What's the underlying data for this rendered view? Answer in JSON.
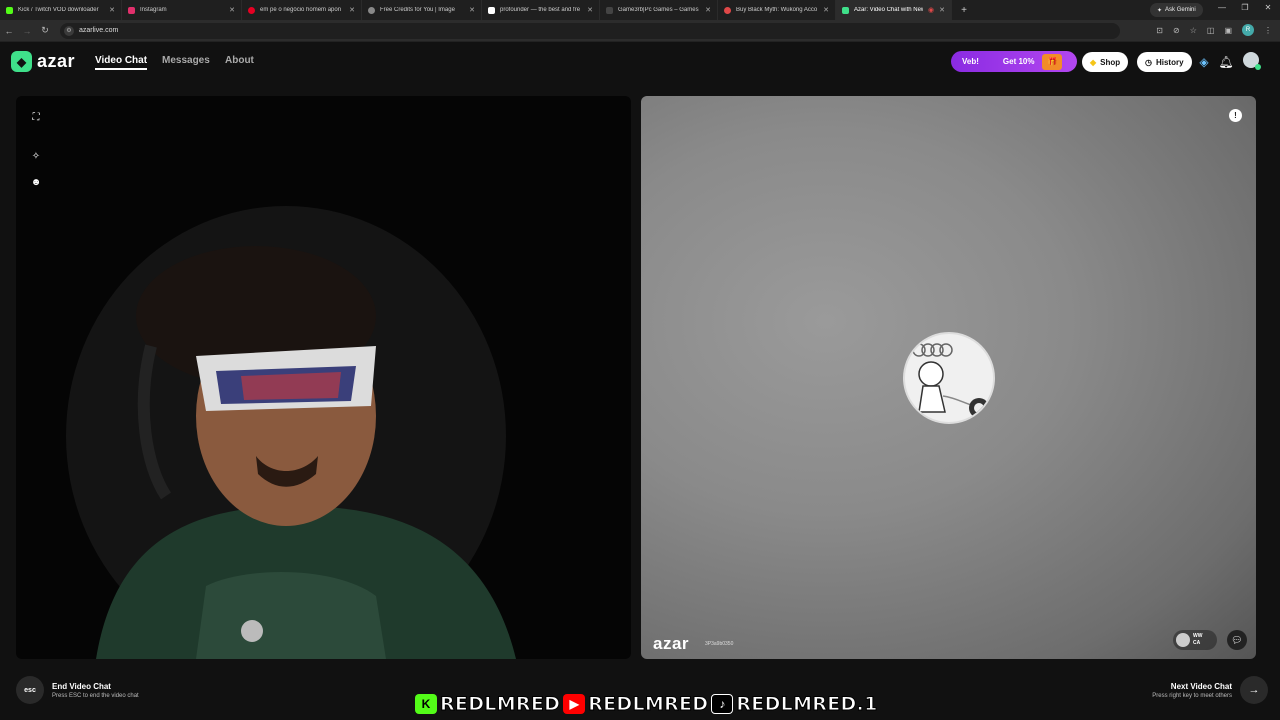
{
  "browser": {
    "tabs": [
      {
        "title": "Kick / Twitch VOD downloader",
        "color": "#53fc18",
        "active": false
      },
      {
        "title": "Instagram",
        "color": "#e1306c",
        "active": false
      },
      {
        "title": "em pé o negócio homem apon",
        "color": "#e60023",
        "active": false
      },
      {
        "title": "Free Credits for You  |  Image",
        "color": "#888888",
        "active": false
      },
      {
        "title": "profounder — the best and fre",
        "color": "#ffffff",
        "active": false
      },
      {
        "title": "Game3rb|Pc Games – Games Cr",
        "color": "#222222",
        "active": false
      },
      {
        "title": "Buy Black Myth: Wukong Acco",
        "color": "#e04848",
        "active": false
      },
      {
        "title": "Azar: Video Chat with New",
        "color": "#3fe08a",
        "active": true
      }
    ],
    "new_tab": "+",
    "gemini": "Ask Gemini",
    "url": "azarlive.com",
    "profile_initial": "R"
  },
  "app": {
    "logo": "azar",
    "nav": [
      "Video Chat",
      "Messages",
      "About"
    ],
    "promo": {
      "left": "Veb!",
      "right": "Get 10%"
    },
    "shop": "Shop",
    "history": "History"
  },
  "peer": {
    "watermark": "azar",
    "id": "3P3a9b0350",
    "name": "WW",
    "country": "CA"
  },
  "footer": {
    "end_title": "End Video Chat",
    "end_sub": "Press ESC to end the video chat",
    "esc": "esc",
    "next_title": "Next Video Chat",
    "next_sub": "Press right key to meet others"
  },
  "streamer": {
    "items": [
      {
        "icon": "kick-icon",
        "glyph": "K",
        "color": "#53fc18",
        "handle": "REDLMRED"
      },
      {
        "icon": "youtube-icon",
        "glyph": "▶",
        "color": "#ff0000",
        "handle": "REDLMRED"
      },
      {
        "icon": "tiktok-icon",
        "glyph": "♪",
        "color": "#000000",
        "handle": "REDLMRED.1"
      }
    ]
  }
}
